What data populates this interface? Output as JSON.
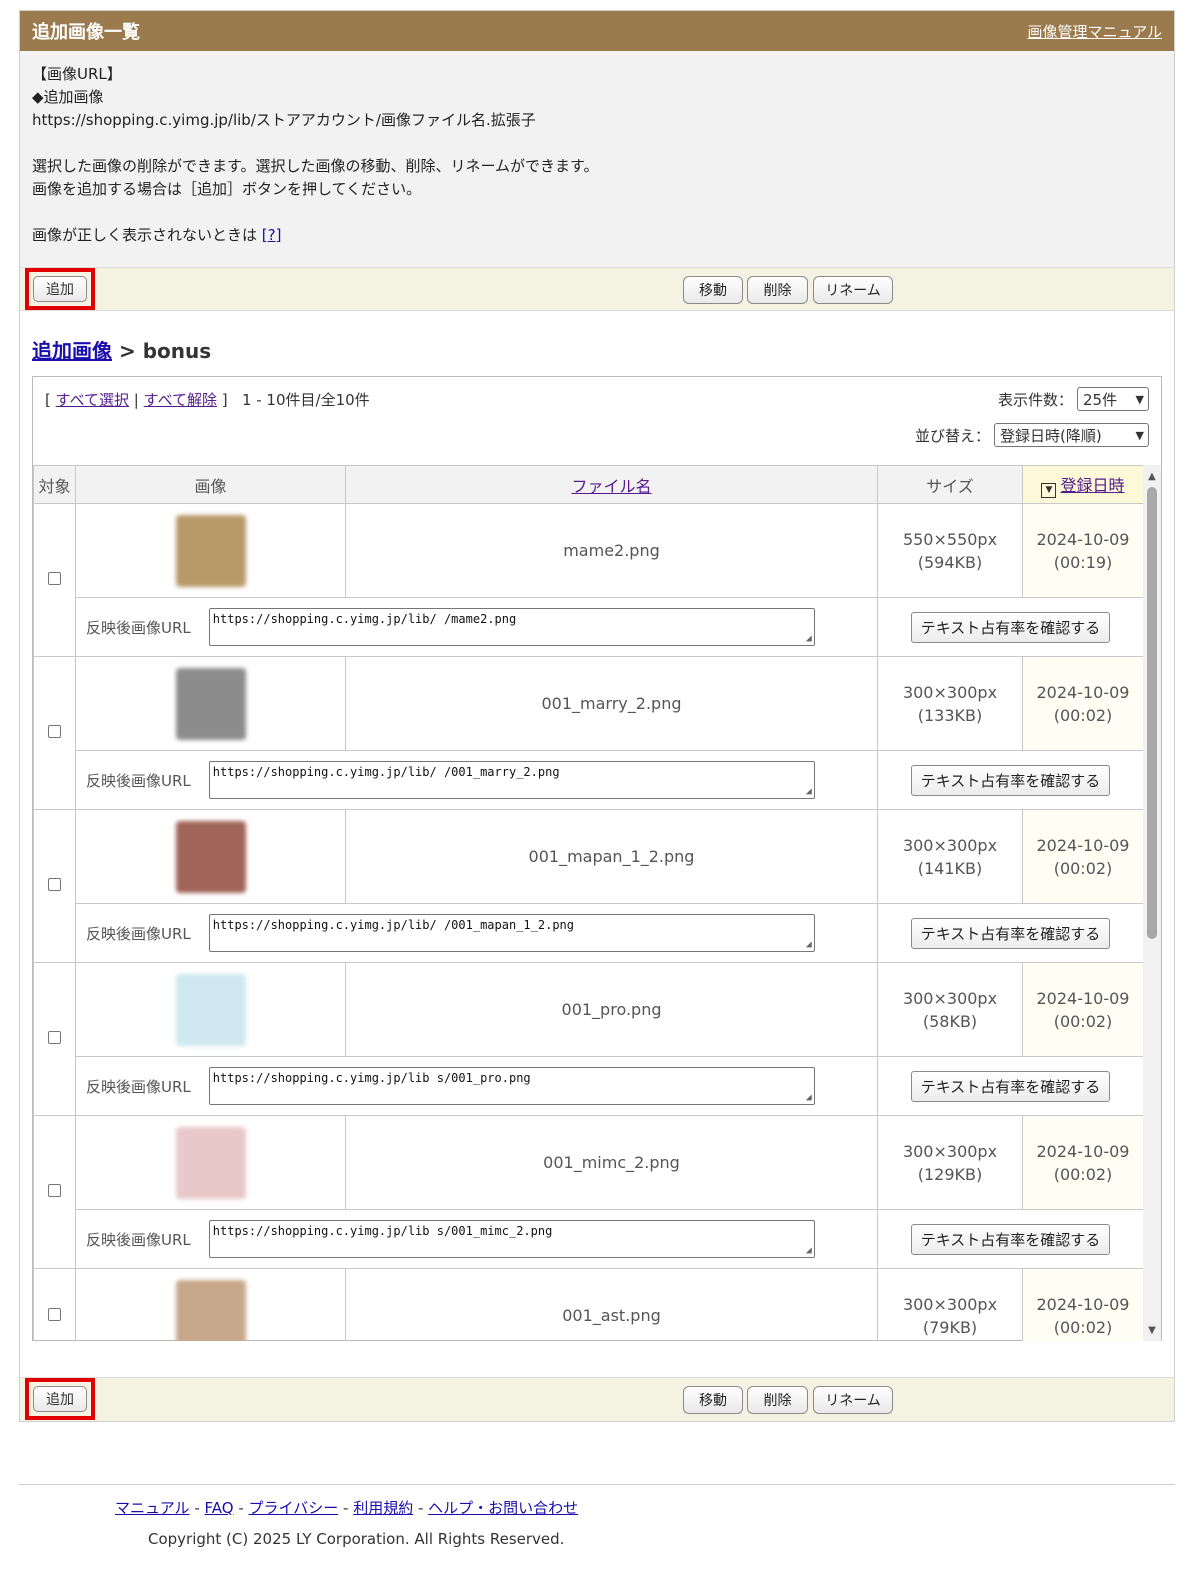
{
  "header": {
    "title": "追加画像一覧",
    "manual_link": "画像管理マニュアル"
  },
  "info": {
    "line1": "【画像URL】",
    "line2": "◆追加画像",
    "line3": "https://shopping.c.yimg.jp/lib/ストアアカウント/画像ファイル名.拡張子",
    "line4": "選択した画像の削除ができます。選択した画像の移動、削除、リネームができます。",
    "line5": "画像を追加する場合は［追加］ボタンを押してください。",
    "line6": "画像が正しく表示されないときは",
    "help_link": "[?]"
  },
  "actions": {
    "add": "追加",
    "move": "移動",
    "delete": "削除",
    "rename": "リネーム"
  },
  "breadcrumb": {
    "root": "追加画像",
    "separator": ">",
    "current": "bonus"
  },
  "list_tools": {
    "open_bracket": "[",
    "select_all": "すべて選択",
    "divider": "|",
    "deselect_all": "すべて解除",
    "close_bracket": "]",
    "count": "1 - 10件目/全10件",
    "per_page_label": "表示件数：",
    "per_page_value": "25件",
    "sort_label": "並び替え：",
    "sort_value": "登録日時(降順)"
  },
  "table": {
    "col_target": "対象",
    "col_image": "画像",
    "col_filename": "ファイル名",
    "col_size": "サイズ",
    "col_date": "登録日時",
    "sort_indicator": "▼",
    "url_label": "反映後画像URL",
    "text_check_button": "テキスト占有率を確認する",
    "rows": [
      {
        "filename": "mame2.png",
        "dims": "550×550px",
        "bytes": "(594KB)",
        "date": "2024-10-09",
        "time": "(00:19)",
        "url": "https://shopping.c.yimg.jp/lib/        /mame2.png",
        "thumb_color": "#b89a6a"
      },
      {
        "filename": "001_marry_2.png",
        "dims": "300×300px",
        "bytes": "(133KB)",
        "date": "2024-10-09",
        "time": "(00:02)",
        "url": "https://shopping.c.yimg.jp/lib/        /001_marry_2.png",
        "thumb_color": "#8c8c8c"
      },
      {
        "filename": "001_mapan_1_2.png",
        "dims": "300×300px",
        "bytes": "(141KB)",
        "date": "2024-10-09",
        "time": "(00:02)",
        "url": "https://shopping.c.yimg.jp/lib/        /001_mapan_1_2.png",
        "thumb_color": "#a0645a"
      },
      {
        "filename": "001_pro.png",
        "dims": "300×300px",
        "bytes": "(58KB)",
        "date": "2024-10-09",
        "time": "(00:02)",
        "url": "https://shopping.c.yimg.jp/lib      s/001_pro.png",
        "thumb_color": "#cfe8f0"
      },
      {
        "filename": "001_mimc_2.png",
        "dims": "300×300px",
        "bytes": "(129KB)",
        "date": "2024-10-09",
        "time": "(00:02)",
        "url": "https://shopping.c.yimg.jp/lib      s/001_mimc_2.png",
        "thumb_color": "#e8c8c8"
      },
      {
        "filename": "001_ast.png",
        "dims": "300×300px",
        "bytes": "(79KB)",
        "date": "2024-10-09",
        "time": "(00:02)",
        "url": "",
        "thumb_color": "#c8a88a"
      }
    ]
  },
  "footer": {
    "links": [
      "マニュアル",
      "FAQ",
      "プライバシー",
      "利用規約",
      "ヘルプ・お問い合わせ"
    ],
    "separator": " - ",
    "copyright": "Copyright (C) 2025 LY Corporation. All Rights Reserved."
  }
}
